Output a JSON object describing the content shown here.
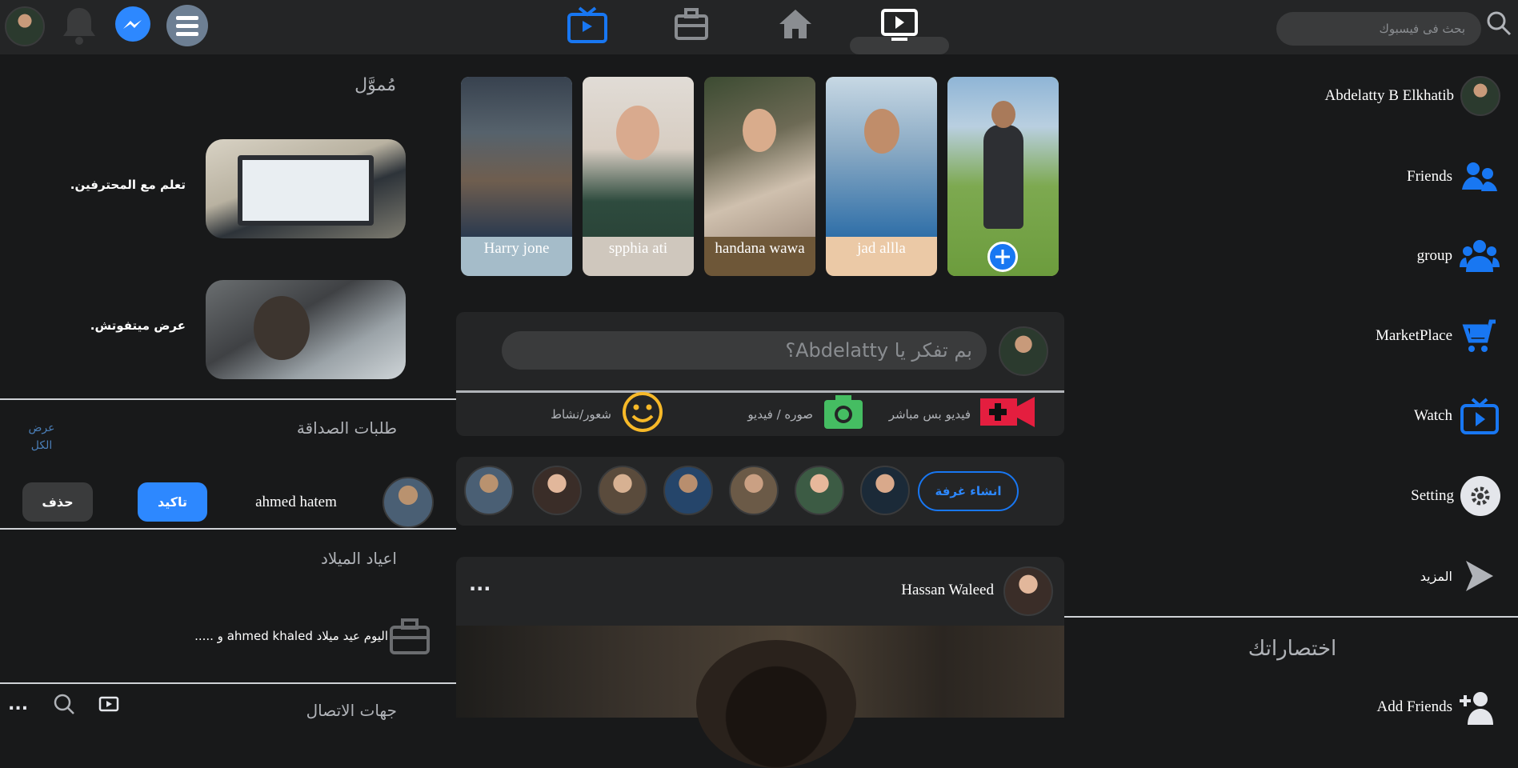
{
  "topbar": {
    "search_placeholder": "بحث فى فيسبوك",
    "icons": [
      "search-icon",
      "watch-nav-icon",
      "home-icon",
      "marketplace-nav-icon",
      "tv-nav-icon",
      "menu-icon",
      "messenger-icon",
      "bell-icon"
    ],
    "accent": "#1877f2"
  },
  "sidebar_right": {
    "profile_name": "Abdelatty B Elkhatib",
    "items": [
      {
        "label": "Friends",
        "icon": "friends-icon"
      },
      {
        "label": "group",
        "icon": "group-icon"
      },
      {
        "label": "MarketPlace",
        "icon": "cart-icon"
      },
      {
        "label": "Watch",
        "icon": "watch-icon"
      },
      {
        "label": "Setting",
        "icon": "gear-icon"
      },
      {
        "label": "المزيد",
        "icon": "chevron-right-icon"
      }
    ],
    "shortcuts_title": "اختصاراتك",
    "shortcut_add_friends": "Add Friends"
  },
  "stories": [
    {
      "name": "",
      "is_own": true
    },
    {
      "name": "jad allla"
    },
    {
      "name": "handana wawa"
    },
    {
      "name": "spphia ati"
    },
    {
      "name": "Harry jone"
    }
  ],
  "composer": {
    "placeholder": "بم تفكر يا Abdelatty؟",
    "actions": [
      {
        "label": "فيديو بس مباشر",
        "icon": "live-video-icon",
        "color": "#e41e3f"
      },
      {
        "label": "صوره / فيديو",
        "icon": "camera-icon",
        "color": "#45bd62"
      },
      {
        "label": "شعور/نشاط",
        "icon": "smiley-icon",
        "color": "#f7b928"
      }
    ]
  },
  "rooms": {
    "create_room_label": "انشاء غرفة"
  },
  "post": {
    "author": "Hassan Waleed",
    "more": "..."
  },
  "sponsored": {
    "title": "مُموَّل",
    "ads": [
      {
        "text": "تعلم مع المحترفين."
      },
      {
        "text": "عرض ميتفوتش."
      }
    ]
  },
  "friend_requests": {
    "title": "طلبات الصداقة",
    "see_all": "عرض الكل",
    "name": "ahmed hatem",
    "confirm": "تاكيد",
    "delete": "حذف"
  },
  "birthdays": {
    "title": "اعياد الميلاد",
    "text": "اليوم عيد ميلاد ahmed khaled و ....."
  },
  "contacts": {
    "title": "جهات الاتصال",
    "more": "..."
  }
}
